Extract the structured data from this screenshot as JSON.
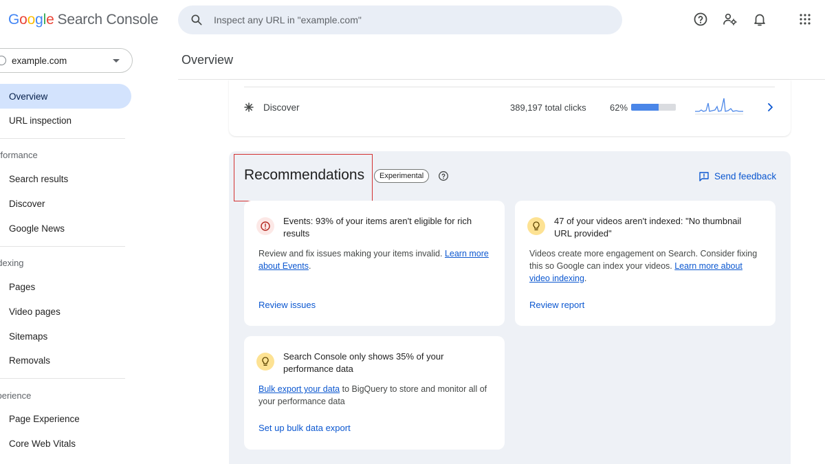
{
  "header": {
    "logo_letters": [
      {
        "ch": "G",
        "color": "#4285f4"
      },
      {
        "ch": "o",
        "color": "#ea4335"
      },
      {
        "ch": "o",
        "color": "#fbbc05"
      },
      {
        "ch": "g",
        "color": "#4285f4"
      },
      {
        "ch": "l",
        "color": "#34a853"
      },
      {
        "ch": "e",
        "color": "#ea4335"
      }
    ],
    "product_name": "Search Console",
    "search_placeholder": "Inspect any URL in \"example.com\"",
    "icons": [
      "help-icon",
      "manage-users-icon",
      "notifications-icon",
      "apps-grid-icon"
    ]
  },
  "sidebar": {
    "property": "example.com",
    "items": [
      {
        "label": "Overview",
        "active": true
      },
      {
        "label": "URL inspection",
        "active": false
      }
    ],
    "sections": [
      {
        "label": "erformance",
        "items": [
          "Search results",
          "Discover",
          "Google News"
        ]
      },
      {
        "label": "ndexing",
        "items": [
          "Pages",
          "Video pages",
          "Sitemaps",
          "Removals"
        ]
      },
      {
        "label": "xperience",
        "items": [
          "Page Experience",
          "Core Web Vitals"
        ]
      }
    ]
  },
  "main": {
    "title": "Overview",
    "discover_row": {
      "label": "Discover",
      "clicks": "389,197 total clicks",
      "percent_label": "62%",
      "percent_value": 0.62
    },
    "recommendations": {
      "title": "Recommendations",
      "badge": "Experimental",
      "feedback": "Send feedback",
      "cards": [
        {
          "type": "error",
          "title": "Events: 93% of your items aren't eligible for rich results",
          "body": "Review and fix issues making your items invalid. ",
          "link": "Learn more about Events",
          "body_after": ".",
          "action": "Review issues"
        },
        {
          "type": "tip",
          "title": "47 of your videos aren't indexed: \"No thumbnail URL provided\"",
          "body": "Videos create more engagement on Search. Consider fixing this so Google can index your videos. ",
          "link": "Learn more about video indexing",
          "body_after": ".",
          "action": "Review report"
        },
        {
          "type": "tip",
          "title": "Search Console only shows 35% of your performance data",
          "link": "Bulk export your data",
          "body": " to BigQuery to store and monitor all of your performance data",
          "action": "Set up bulk data export"
        }
      ]
    }
  },
  "colors": {
    "accent": "#0b57d0",
    "active_nav": "#d3e3fd",
    "panel_bg": "#eef1f6",
    "highlight": "#d32f2f",
    "bar_fill": "#4a86e8"
  }
}
